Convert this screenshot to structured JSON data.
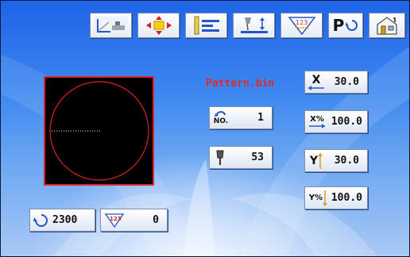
{
  "toolbar": {
    "items": [
      {
        "name": "pattern-input",
        "icon": "pattern-input-icon"
      },
      {
        "name": "move-origin",
        "icon": "move-cross-icon"
      },
      {
        "name": "align-left",
        "icon": "align-left-icon"
      },
      {
        "name": "needle-height",
        "icon": "needle-height-icon"
      },
      {
        "name": "counter-setting",
        "icon": "counter-icon",
        "badge": "123"
      },
      {
        "name": "parameter",
        "icon": "p-cycle-icon",
        "label": "P"
      },
      {
        "name": "home",
        "icon": "home-icon"
      }
    ]
  },
  "pattern": {
    "filename": "Pattern.bin"
  },
  "fields": {
    "x_label": "X",
    "x_value": "30.0",
    "xscale_label": "X%",
    "xscale_value": "100.0",
    "y_label": "Y",
    "y_value": "30.0",
    "yscale_label": "Y%",
    "yscale_value": "100.0",
    "no_label": "NO.",
    "no_value": "1",
    "speed_value": "53",
    "stitch_count": "2300",
    "counter_badge": "123",
    "counter_value": "0"
  },
  "colors": {
    "preview_border": "#e0202a",
    "stitch_circle": "#e02020",
    "pattern_name": "#e22828"
  }
}
